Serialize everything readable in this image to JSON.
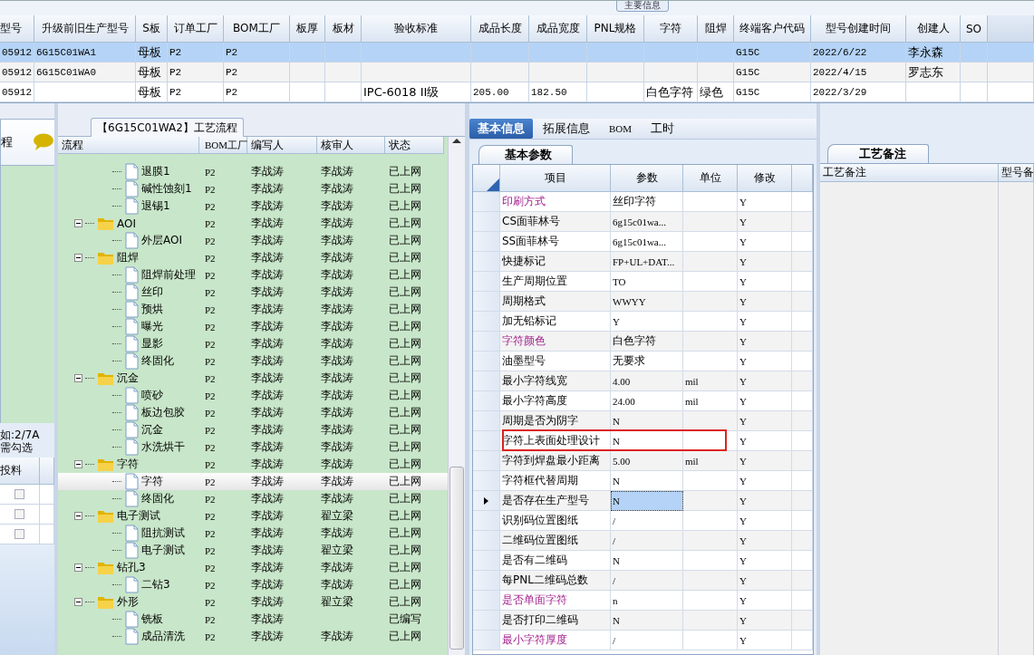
{
  "main_info": {
    "tab": "主要信息",
    "columns": [
      "型号",
      "升级前旧生产型号",
      "S板",
      "订单工厂",
      "BOM工厂",
      "板厚",
      "板材",
      "验收标准",
      "成品长度",
      "成品宽度",
      "PNL规格",
      "字符",
      "阻焊",
      "终端客户代码",
      "型号创建时间",
      "创建人",
      "SO"
    ],
    "rows": [
      {
        "selected": true,
        "cells": [
          "05912",
          "6G15C01WA1",
          "母板",
          "P2",
          "P2",
          null,
          null,
          null,
          null,
          null,
          null,
          null,
          null,
          "G15C",
          "2022/6/22",
          "李永森",
          null
        ]
      },
      {
        "selected": false,
        "cells": [
          "05912",
          "6G15C01WA0",
          "母板",
          "P2",
          "P2",
          null,
          null,
          null,
          null,
          null,
          null,
          null,
          null,
          "G15C",
          "2022/4/15",
          "罗志东",
          null
        ]
      },
      {
        "selected": false,
        "cells": [
          "05912",
          null,
          "母板",
          "P2",
          "P2",
          null,
          null,
          "IPC-6018 II级",
          "205.00",
          "182.50",
          null,
          "白色字符",
          "绿色",
          "G15C",
          "2022/3/29",
          null,
          null
        ]
      }
    ]
  },
  "left_panel": {
    "title": "程",
    "hint_lines": [
      "如:2/7A",
      "需勾选"
    ],
    "column": "投料",
    "rows": [
      {
        "checked": false
      },
      {
        "checked": false
      },
      {
        "checked": false
      }
    ]
  },
  "flow": {
    "tab": "【6G15C01WA2】工艺流程",
    "columns": [
      "流程",
      "BOM工厂",
      "编写人",
      "核审人",
      "状态"
    ],
    "rows": [
      {
        "children": [
          {
            "name": "退膜1",
            "bom": "P2",
            "writer": "李战涛",
            "reviewer": "李战涛",
            "status": "已上网",
            "selected": false
          },
          {
            "name": "碱性蚀刻1",
            "bom": "P2",
            "writer": "李战涛",
            "reviewer": "李战涛",
            "status": "已上网",
            "selected": false
          },
          {
            "name": "退锡1",
            "bom": "P2",
            "writer": "李战涛",
            "reviewer": "李战涛",
            "status": "已上网",
            "selected": false
          }
        ]
      },
      {
        "name": "AOI",
        "bom": "P2",
        "writer": "李战涛",
        "reviewer": "李战涛",
        "status": "已上网",
        "selected": false,
        "expanded": true,
        "children": [
          {
            "name": "外层AOI",
            "bom": "P2",
            "writer": "李战涛",
            "reviewer": "李战涛",
            "status": "已上网",
            "selected": false
          }
        ]
      },
      {
        "name": "阻焊",
        "bom": "P2",
        "writer": "李战涛",
        "reviewer": "李战涛",
        "status": "已上网",
        "selected": false,
        "expanded": true,
        "children": [
          {
            "name": "阻焊前处理",
            "bom": "P2",
            "writer": "李战涛",
            "reviewer": "李战涛",
            "status": "已上网",
            "selected": false
          },
          {
            "name": "丝印",
            "bom": "P2",
            "writer": "李战涛",
            "reviewer": "李战涛",
            "status": "已上网",
            "selected": false
          },
          {
            "name": "预烘",
            "bom": "P2",
            "writer": "李战涛",
            "reviewer": "李战涛",
            "status": "已上网",
            "selected": false
          },
          {
            "name": "曝光",
            "bom": "P2",
            "writer": "李战涛",
            "reviewer": "李战涛",
            "status": "已上网",
            "selected": false
          },
          {
            "name": "显影",
            "bom": "P2",
            "writer": "李战涛",
            "reviewer": "李战涛",
            "status": "已上网",
            "selected": false
          },
          {
            "name": "终固化",
            "bom": "P2",
            "writer": "李战涛",
            "reviewer": "李战涛",
            "status": "已上网",
            "selected": false
          }
        ]
      },
      {
        "name": "沉金",
        "bom": "P2",
        "writer": "李战涛",
        "reviewer": "李战涛",
        "status": "已上网",
        "selected": false,
        "expanded": true,
        "children": [
          {
            "name": "喷砂",
            "bom": "P2",
            "writer": "李战涛",
            "reviewer": "李战涛",
            "status": "已上网",
            "selected": false
          },
          {
            "name": "板边包胶",
            "bom": "P2",
            "writer": "李战涛",
            "reviewer": "李战涛",
            "status": "已上网",
            "selected": false
          },
          {
            "name": "沉金",
            "bom": "P2",
            "writer": "李战涛",
            "reviewer": "李战涛",
            "status": "已上网",
            "selected": false
          },
          {
            "name": "水洗烘干",
            "bom": "P2",
            "writer": "李战涛",
            "reviewer": "李战涛",
            "status": "已上网",
            "selected": false
          }
        ]
      },
      {
        "name": "字符",
        "bom": "P2",
        "writer": "李战涛",
        "reviewer": "李战涛",
        "status": "已上网",
        "selected": false,
        "expanded": true,
        "children": [
          {
            "name": "字符",
            "bom": "P2",
            "writer": "李战涛",
            "reviewer": "李战涛",
            "status": "已上网",
            "selected": true
          },
          {
            "name": "终固化",
            "bom": "P2",
            "writer": "李战涛",
            "reviewer": "李战涛",
            "status": "已上网",
            "selected": false
          }
        ]
      },
      {
        "name": "电子测试",
        "bom": "P2",
        "writer": "李战涛",
        "reviewer": "翟立梁",
        "status": "已上网",
        "selected": false,
        "expanded": true,
        "children": [
          {
            "name": "阻抗测试",
            "bom": "P2",
            "writer": "李战涛",
            "reviewer": "李战涛",
            "status": "已上网",
            "selected": false
          },
          {
            "name": "电子测试",
            "bom": "P2",
            "writer": "李战涛",
            "reviewer": "翟立梁",
            "status": "已上网",
            "selected": false
          }
        ]
      },
      {
        "name": "钻孔3",
        "bom": "P2",
        "writer": "李战涛",
        "reviewer": "李战涛",
        "status": "已上网",
        "selected": false,
        "expanded": true,
        "children": [
          {
            "name": "二钻3",
            "bom": "P2",
            "writer": "李战涛",
            "reviewer": "李战涛",
            "status": "已上网",
            "selected": false
          }
        ]
      },
      {
        "name": "外形",
        "bom": "P2",
        "writer": "李战涛",
        "reviewer": "翟立梁",
        "status": "已上网",
        "selected": false,
        "expanded": true,
        "children": [
          {
            "name": "铣板",
            "bom": "P2",
            "writer": "李战涛",
            "status": "已编写",
            "selected": false
          },
          {
            "name": "成品清洗",
            "bom": "P2",
            "writer": "李战涛",
            "reviewer": "李战涛",
            "status": "已上网",
            "selected": false
          }
        ]
      }
    ]
  },
  "details": {
    "tabs": [
      {
        "label": "基本信息",
        "selected": true
      },
      {
        "label": "拓展信息",
        "selected": false
      },
      {
        "label": "BOM",
        "selected": false
      },
      {
        "label": "工时",
        "selected": false
      }
    ],
    "subtab": "基本参数",
    "columns": [
      "项目",
      "参数",
      "单位",
      "修改"
    ],
    "rows": [
      {
        "item": "印刷方式",
        "value": "丝印字符",
        "modify": "Y",
        "emphasis": true
      },
      {
        "item": "CS面菲林号",
        "value": "6g15c01wa...",
        "modify": "Y"
      },
      {
        "item": "SS面菲林号",
        "value": "6g15c01wa...",
        "modify": "Y"
      },
      {
        "item": "快捷标记",
        "value": "FP+UL+DAT...",
        "modify": "Y"
      },
      {
        "item": "生产周期位置",
        "value": "TO",
        "modify": "Y"
      },
      {
        "item": "周期格式",
        "value": "WWYY",
        "modify": "Y"
      },
      {
        "item": "加无铅标记",
        "value": "Y",
        "modify": "Y"
      },
      {
        "item": "字符颜色",
        "value": "白色字符",
        "modify": "Y",
        "emphasis": true
      },
      {
        "item": "油墨型号",
        "value": "无要求",
        "modify": "Y"
      },
      {
        "item": "最小字符线宽",
        "value": "4.00",
        "unit": "mil",
        "modify": "Y"
      },
      {
        "item": "最小字符高度",
        "value": "24.00",
        "unit": "mil",
        "modify": "Y"
      },
      {
        "item": "周期是否为阴字",
        "value": "N",
        "modify": "Y"
      },
      {
        "item": "字符上表面处理设计",
        "value": "N",
        "modify": "Y",
        "flagged": true
      },
      {
        "item": "字符到焊盘最小距离",
        "value": "5.00",
        "unit": "mil",
        "modify": "Y"
      },
      {
        "item": "字符框代替周期",
        "value": "N",
        "modify": "Y"
      },
      {
        "item": "是否存在生产型号",
        "value": "N",
        "modify": "Y",
        "selected": true
      },
      {
        "item": "识别码位置图纸",
        "value": "/",
        "modify": "Y"
      },
      {
        "item": "二维码位置图纸",
        "value": "/",
        "modify": "Y"
      },
      {
        "item": "是否有二维码",
        "value": "N",
        "modify": "Y"
      },
      {
        "item": "每PNL二维码总数",
        "value": "/",
        "modify": "Y"
      },
      {
        "item": "是否单面字符",
        "value": "n",
        "modify": "Y",
        "emphasis": true
      },
      {
        "item": "是否打印二维码",
        "value": "N",
        "modify": "Y"
      },
      {
        "item": "最小字符厚度",
        "value": "/",
        "modify": "Y",
        "emphasis": true
      }
    ]
  },
  "notes": {
    "tab": "工艺备注",
    "columns": [
      "工艺备注",
      "型号备"
    ]
  }
}
